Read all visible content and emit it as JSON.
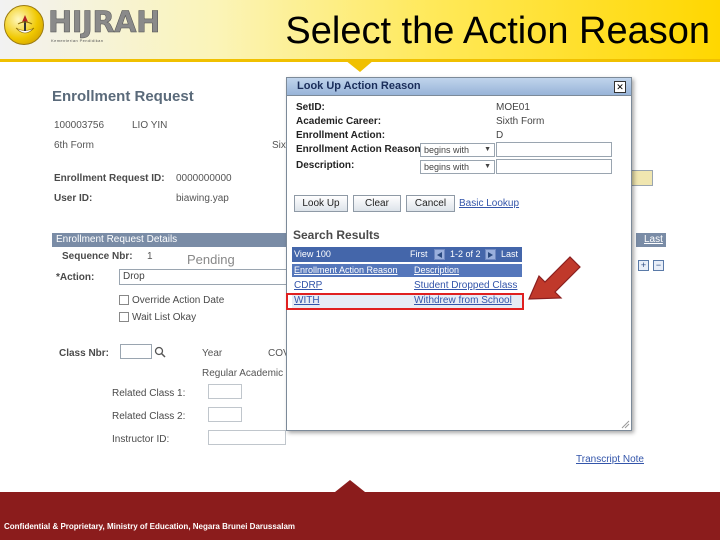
{
  "slide": {
    "logo_text": "HIJRAH",
    "logo_tagline": "Kementerian Pendidikan",
    "title": "Select the Action Reason",
    "footer": "Confidential & Proprietary, Ministry of Education, Negara Brunei Darussalam"
  },
  "enrollment_page": {
    "title": "Enrollment Request",
    "student_id": "100003756",
    "student_name": "LIO YIN",
    "career": "6th Form",
    "career_partial": "Six",
    "request_id_label": "Enrollment Request ID:",
    "request_id_value": "0000000000",
    "user_id_label": "User ID:",
    "user_id_value": "biawing.yap",
    "details_section": "Enrollment Request Details",
    "sequence_label": "Sequence Nbr:",
    "sequence_value": "1",
    "status": "Pending",
    "action_label": "*Action:",
    "action_value": "Drop",
    "override_label": "Override Action Date",
    "waitlist_label": "Wait List Okay",
    "class_nbr_label": "Class Nbr:",
    "year_label": "Year",
    "partial_cov": "COV",
    "regular_academic": "Regular Academic",
    "related_class_1": "Related Class 1:",
    "related_class_2": "Related Class 2:",
    "instructor_label": "Instructor ID:",
    "last_link": "Last",
    "transcript_link": "Transcript Note"
  },
  "popup": {
    "title": "Look Up Action Reason",
    "fields": [
      {
        "label": "SetID:",
        "value": "MOE01"
      },
      {
        "label": "Academic Career:",
        "value": "Sixth Form"
      },
      {
        "label": "Enrollment Action:",
        "value": "D"
      }
    ],
    "search_fields": [
      {
        "label": "Enrollment Action Reason:",
        "operator": "begins with",
        "value": ""
      },
      {
        "label": "Description:",
        "operator": "begins with",
        "value": ""
      }
    ],
    "buttons": {
      "lookup": "Look Up",
      "clear": "Clear",
      "cancel": "Cancel",
      "basic_lookup": "Basic Lookup"
    },
    "results_title": "Search Results",
    "nav": {
      "view": "View 100",
      "first": "First",
      "range": "1-2 of 2",
      "last": "Last"
    },
    "columns": [
      "Enrollment Action Reason",
      "Description"
    ],
    "rows": [
      {
        "code": "CDRP",
        "description": "Student Dropped Class"
      },
      {
        "code": "WITH",
        "description": "Withdrew from School"
      }
    ]
  },
  "colors": {
    "header_gold": "#ffd700",
    "footer_maroon": "#8b1c1c",
    "highlight_red": "#e02020",
    "ps_blue": "#4466aa"
  }
}
